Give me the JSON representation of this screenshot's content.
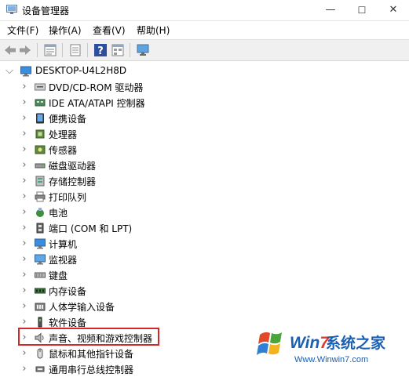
{
  "window": {
    "title": "设备管理器",
    "min": "—",
    "max": "☐",
    "close": "✕"
  },
  "menu": [
    {
      "label": "文件(F)"
    },
    {
      "label": "操作(A)"
    },
    {
      "label": "查看(V)"
    },
    {
      "label": "帮助(H)"
    }
  ],
  "toolbar": [
    "back-icon",
    "forward-icon",
    "properties-icon",
    "update-driver-icon",
    "help-icon",
    "view-icon",
    "monitor-scan-icon"
  ],
  "tree": {
    "root": "DESKTOP-U4L2H8D",
    "items": [
      {
        "label": "DVD/CD-ROM 驱动器",
        "icon": "dvd-icon"
      },
      {
        "label": "IDE ATA/ATAPI 控制器",
        "icon": "ide-controller-icon"
      },
      {
        "label": "便携设备",
        "icon": "portable-device-icon"
      },
      {
        "label": "处理器",
        "icon": "cpu-icon"
      },
      {
        "label": "传感器",
        "icon": "sensor-icon"
      },
      {
        "label": "磁盘驱动器",
        "icon": "disk-drive-icon"
      },
      {
        "label": "存储控制器",
        "icon": "storage-controller-icon"
      },
      {
        "label": "打印队列",
        "icon": "printer-icon"
      },
      {
        "label": "电池",
        "icon": "battery-icon"
      },
      {
        "label": "端口 (COM 和 LPT)",
        "icon": "port-icon"
      },
      {
        "label": "计算机",
        "icon": "computer-icon"
      },
      {
        "label": "监视器",
        "icon": "monitor-icon"
      },
      {
        "label": "键盘",
        "icon": "keyboard-icon"
      },
      {
        "label": "内存设备",
        "icon": "memory-icon"
      },
      {
        "label": "人体学输入设备",
        "icon": "hid-icon"
      },
      {
        "label": "软件设备",
        "icon": "software-device-icon"
      },
      {
        "label": "声音、视频和游戏控制器",
        "icon": "speaker-icon"
      },
      {
        "label": "鼠标和其他指针设备",
        "icon": "mouse-icon"
      },
      {
        "label": "通用串行总线控制器",
        "icon": "usb-icon"
      }
    ]
  },
  "watermark": {
    "brand_a": "Win",
    "brand_b": "7",
    "brand_c": "系统之家",
    "url": "Www.Winwin7.com"
  },
  "colors": {
    "highlight_border": "#d32828",
    "brand_blue": "#1a5fb4"
  }
}
